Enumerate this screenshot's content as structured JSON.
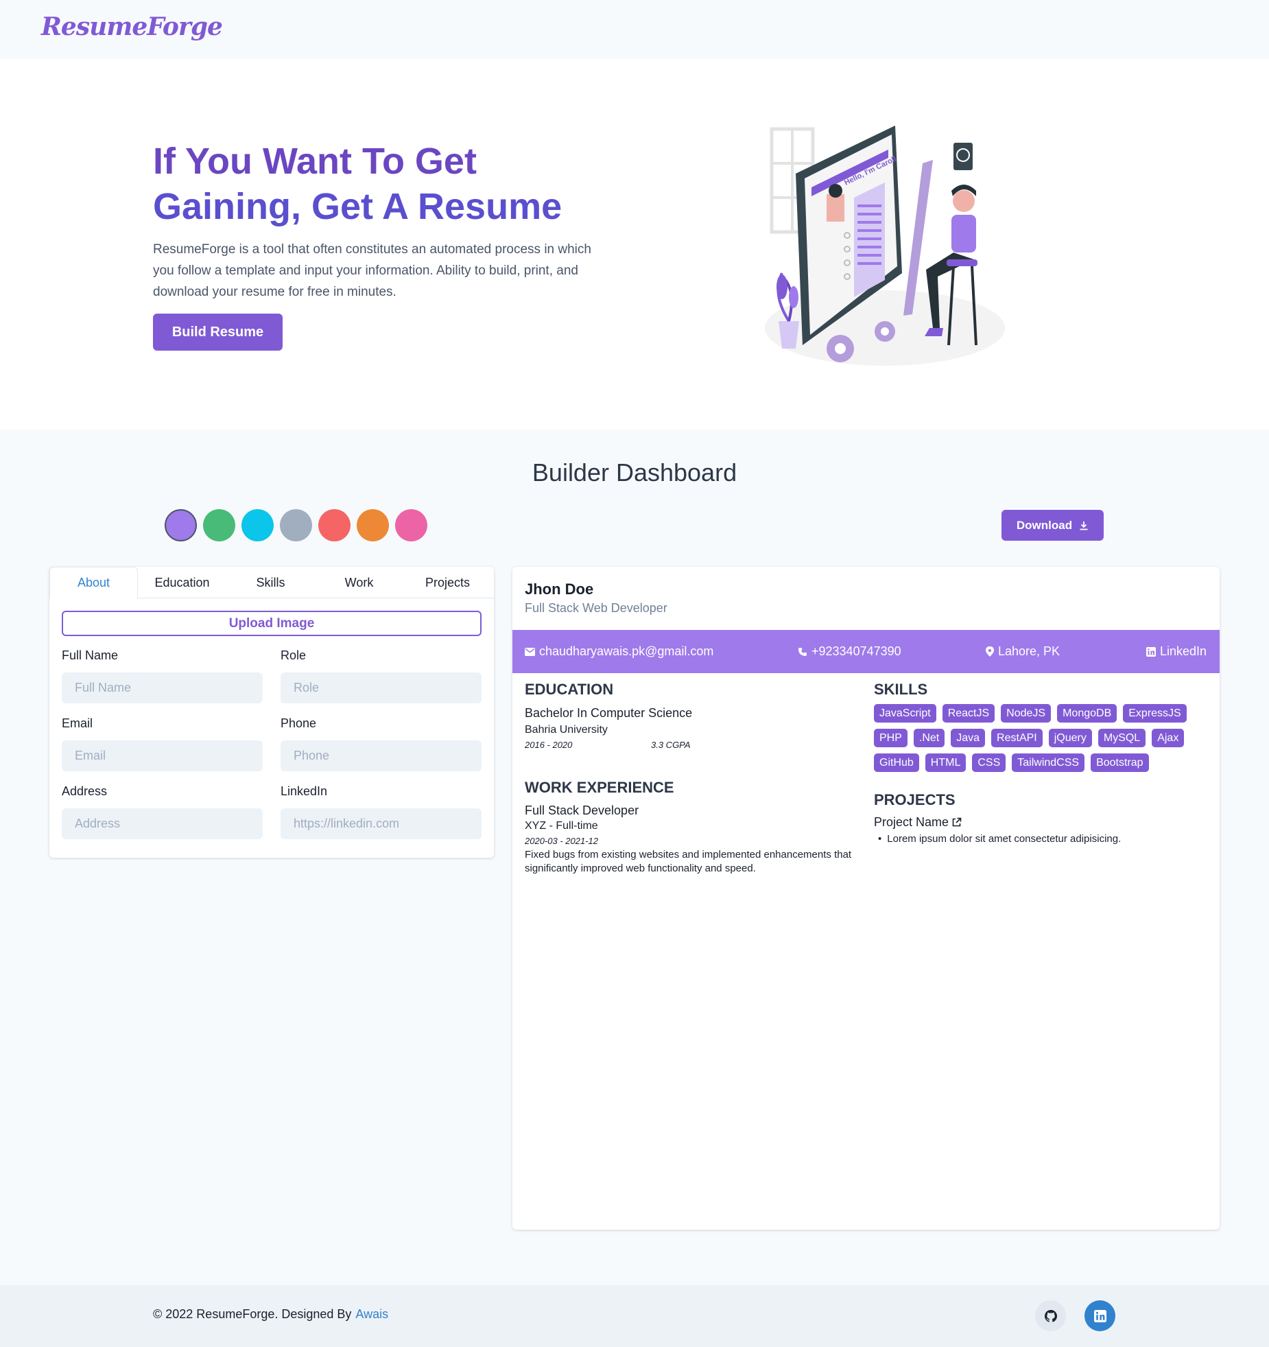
{
  "header": {
    "logo": "ResumeForge"
  },
  "hero": {
    "title_line1": "If You Want To Get",
    "title_line2": "Gaining, Get A Resume",
    "description": "ResumeForge is a tool that often constitutes an automated process in which you follow a template and input your information. Ability to build, print, and download your resume for free in minutes.",
    "cta_label": "Build Resume",
    "illustration_text": "Hello, I'm Caroll"
  },
  "builder": {
    "title": "Builder Dashboard",
    "theme_colors": [
      "#9f7aea",
      "#48bb78",
      "#0bc5ea",
      "#a0aec0",
      "#f56565",
      "#ed8936",
      "#ed64a6"
    ],
    "selected_color": "#9f7aea",
    "download_label": "Download"
  },
  "form": {
    "tabs": [
      "About",
      "Education",
      "Skills",
      "Work",
      "Projects"
    ],
    "active_tab": "About",
    "upload_label": "Upload Image",
    "fields": {
      "full_name": {
        "label": "Full Name",
        "placeholder": "Full Name",
        "value": ""
      },
      "role": {
        "label": "Role",
        "placeholder": "Role",
        "value": ""
      },
      "email": {
        "label": "Email",
        "placeholder": "Email",
        "value": ""
      },
      "phone": {
        "label": "Phone",
        "placeholder": "Phone",
        "value": ""
      },
      "address": {
        "label": "Address",
        "placeholder": "Address",
        "value": ""
      },
      "linkedin": {
        "label": "LinkedIn",
        "placeholder": "https://linkedin.com",
        "value": ""
      }
    }
  },
  "resume": {
    "name": "Jhon Doe",
    "role": "Full Stack Web Developer",
    "contact": {
      "email": "chaudharyawais.pk@gmail.com",
      "phone": "+923340747390",
      "location": "Lahore, PK",
      "linkedin": "LinkedIn"
    },
    "education_heading": "EDUCATION",
    "education": {
      "degree": "Bachelor In Computer Science",
      "school": "Bahria University",
      "years": "2016 - 2020",
      "gpa": "3.3 CGPA"
    },
    "work_heading": "WORK EXPERIENCE",
    "work": {
      "title": "Full Stack Developer",
      "company": "XYZ - Full-time",
      "dates": "2020-03 - 2021-12",
      "description": "Fixed bugs from existing websites and implemented enhancements that significantly improved web functionality and speed."
    },
    "skills_heading": "SKILLS",
    "skills": [
      "JavaScript",
      "ReactJS",
      "NodeJS",
      "MongoDB",
      "ExpressJS",
      "PHP",
      ".Net",
      "Java",
      "RestAPI",
      "jQuery",
      "MySQL",
      "Ajax",
      "GitHub",
      "HTML",
      "CSS",
      "TailwindCSS",
      "Bootstrap"
    ],
    "projects_heading": "PROJECTS",
    "project": {
      "name": "Project Name",
      "bullet": "Lorem ipsum dolor sit amet consectetur adipisicing."
    }
  },
  "footer": {
    "copyright": "© 2022 ResumeForge. Designed By",
    "author": "Awais",
    "icons": [
      "github-icon",
      "linkedin-icon"
    ]
  }
}
